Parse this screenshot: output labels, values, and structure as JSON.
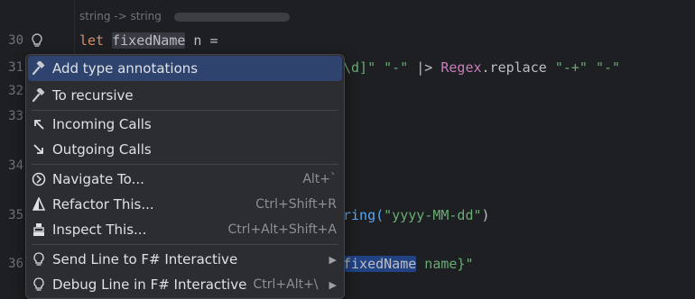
{
  "editor": {
    "inlay_hint": "string -> string",
    "line_numbers": [
      "30",
      "31",
      "32",
      "33",
      "34",
      "35",
      "36"
    ],
    "line30": {
      "let": "let",
      "name": "fixedName",
      "rest": " n ="
    },
    "line31": {
      "a": "\\d]\"",
      "b": " ",
      "c": "\"-\"",
      "d": " |> ",
      "e": "Regex",
      "f": ".replace ",
      "g": "\"-+\"",
      "h": " ",
      "i": "\"-\""
    },
    "line35": {
      "a": "ring(",
      "b": "\"yyyy-MM-dd\"",
      "c": ")"
    },
    "line36": {
      "name": "fixedName",
      "rest": " name}\""
    }
  },
  "context_menu": {
    "items": [
      {
        "label": "Add type annotations",
        "shortcut": "",
        "icon": "hammer-icon",
        "submenu": false,
        "selected": true
      },
      {
        "label": "To recursive",
        "shortcut": "",
        "icon": "hammer-icon",
        "submenu": false,
        "selected": false
      },
      {
        "label": "Incoming Calls",
        "shortcut": "",
        "icon": "arrow-up-left-icon",
        "submenu": false,
        "selected": false
      },
      {
        "label": "Outgoing Calls",
        "shortcut": "",
        "icon": "arrow-down-right-icon",
        "submenu": false,
        "selected": false
      },
      {
        "label": "Navigate To...",
        "shortcut": "Alt+`",
        "icon": "navigate-icon",
        "submenu": false,
        "selected": false
      },
      {
        "label": "Refactor This...",
        "shortcut": "Ctrl+Shift+R",
        "icon": "refactor-icon",
        "submenu": false,
        "selected": false
      },
      {
        "label": "Inspect This...",
        "shortcut": "Ctrl+Alt+Shift+A",
        "icon": "inspect-icon",
        "submenu": false,
        "selected": false
      },
      {
        "label": "Send Line to F# Interactive",
        "shortcut": "",
        "icon": "lightbulb-icon",
        "submenu": true,
        "selected": false
      },
      {
        "label": "Debug Line in F# Interactive",
        "shortcut": "Ctrl+Alt+\\",
        "icon": "lightbulb-icon",
        "submenu": true,
        "selected": false
      }
    ]
  },
  "colors": {
    "background": "#1e1f22",
    "menu_background": "#2b2d30",
    "selection": "#2e436e",
    "keyword": "#cf8e6d",
    "string": "#6aab73",
    "type": "#c77dbb"
  }
}
